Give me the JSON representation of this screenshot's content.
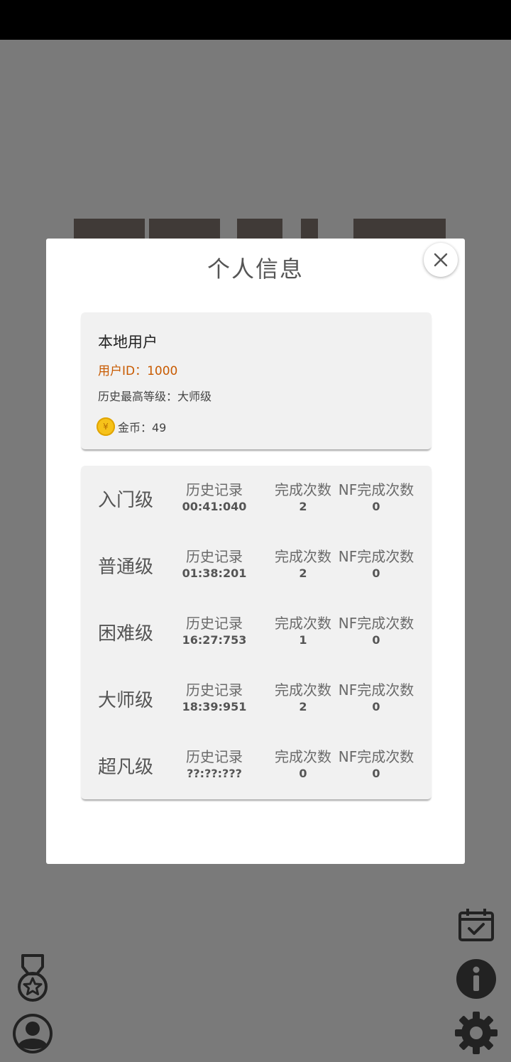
{
  "dialog": {
    "title": "个人信息",
    "close_icon": "close-icon"
  },
  "profile": {
    "name": "本地用户",
    "user_id": "用户ID：1000",
    "best_level": "历史最高等级：大师级",
    "coins": "金币：49",
    "coin_icon": "¥"
  },
  "stats": {
    "rows": [
      {
        "level": "入门级",
        "record_label": "历史记录",
        "record": "00:41:040",
        "done_label": "完成次数",
        "done": "2",
        "nf_label": "NF完成次数",
        "nf": "0"
      },
      {
        "level": "普通级",
        "record_label": "历史记录",
        "record": "01:38:201",
        "done_label": "完成次数",
        "done": "2",
        "nf_label": "NF完成次数",
        "nf": "0"
      },
      {
        "level": "困难级",
        "record_label": "历史记录",
        "record": "16:27:753",
        "done_label": "完成次数",
        "done": "1",
        "nf_label": "NF完成次数",
        "nf": "0"
      },
      {
        "level": "大师级",
        "record_label": "历史记录",
        "record": "18:39:951",
        "done_label": "完成次数",
        "done": "2",
        "nf_label": "NF完成次数",
        "nf": "0"
      },
      {
        "level": "超凡级",
        "record_label": "历史记录",
        "record": "??:??:???",
        "done_label": "完成次数",
        "done": "0",
        "nf_label": "NF完成次数",
        "nf": "0"
      }
    ]
  },
  "bottom_icons": [
    "medal-icon",
    "user-icon",
    "calendar-check-icon",
    "info-icon",
    "settings-icon"
  ],
  "colors": {
    "accent_id": "#c85a00",
    "coin": "#f6c21a",
    "overlay": "#7a7a7a"
  }
}
